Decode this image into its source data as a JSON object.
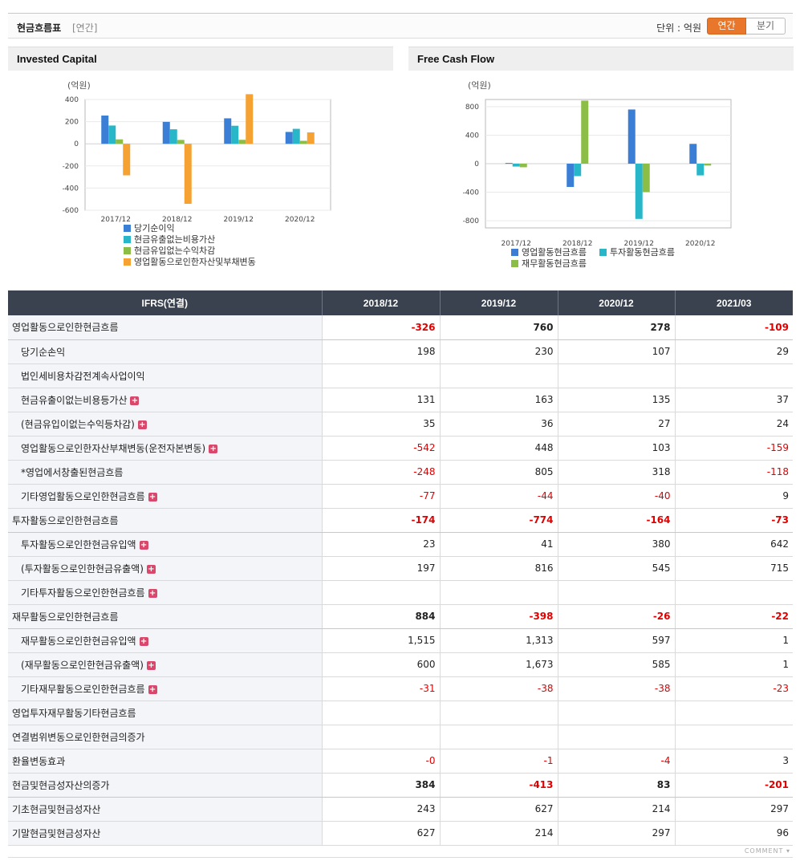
{
  "header": {
    "title": "현금흐름표",
    "period": "[연간]",
    "unit": "단위 : 억원",
    "toggle_annual": "연간",
    "toggle_quarter": "분기"
  },
  "colors": {
    "blue": "#3a7fd5",
    "cyan": "#28b7c8",
    "green": "#8cbd47",
    "orange": "#f5a233"
  },
  "charts": [
    {
      "id": "invested-capital",
      "title": "Invested Capital",
      "unit_label": "(억원)",
      "chart_data": {
        "type": "bar",
        "categories": [
          "2017/12",
          "2018/12",
          "2019/12",
          "2020/12"
        ],
        "ylim": [
          -600,
          400
        ],
        "yticks": [
          400,
          200,
          0,
          -200,
          -400,
          -600
        ],
        "series": [
          {
            "name": "당기순이익",
            "color": "blue",
            "values": [
              255,
              198,
              230,
              107
            ]
          },
          {
            "name": "현금유출없는비용가산",
            "color": "cyan",
            "values": [
              165,
              131,
              163,
              135
            ]
          },
          {
            "name": "현금유입없는수익차감",
            "color": "green",
            "values": [
              40,
              35,
              36,
              27
            ]
          },
          {
            "name": "영업활동으로인한자산및부채변동",
            "color": "orange",
            "values": [
              -285,
              -542,
              448,
              103
            ]
          }
        ],
        "grid": true,
        "legend": "bottom"
      }
    },
    {
      "id": "free-cash-flow",
      "title": "Free Cash Flow",
      "unit_label": "(억원)",
      "chart_data": {
        "type": "bar",
        "categories": [
          "2017/12",
          "2018/12",
          "2019/12",
          "2020/12"
        ],
        "ylim": [
          -900,
          900
        ],
        "yticks": [
          800,
          400,
          0,
          -400,
          -800
        ],
        "series": [
          {
            "name": "영업활동현금흐름",
            "color": "blue",
            "values": [
              10,
              -326,
              760,
              278
            ]
          },
          {
            "name": "투자활동현금흐름",
            "color": "cyan",
            "values": [
              -40,
              -174,
              -774,
              -164
            ]
          },
          {
            "name": "재무활동현금흐름",
            "color": "green",
            "values": [
              -50,
              884,
              -398,
              -26
            ]
          }
        ],
        "grid": true,
        "legend": "bottom"
      }
    }
  ],
  "table": {
    "corner": "IFRS(연결)",
    "columns": [
      "2018/12",
      "2019/12",
      "2020/12",
      "2021/03"
    ],
    "rows": [
      {
        "label": "영업활동으로인한현금흐름",
        "level": "main",
        "expand": false,
        "values": [
          "-326",
          "760",
          "278",
          "-109"
        ]
      },
      {
        "label": "당기순손익",
        "level": "sub",
        "expand": false,
        "values": [
          "198",
          "230",
          "107",
          "29"
        ]
      },
      {
        "label": "법인세비용차감전계속사업이익",
        "level": "sub",
        "expand": false,
        "values": [
          "",
          "",
          "",
          ""
        ]
      },
      {
        "label": "현금유출이없는비용등가산",
        "level": "sub",
        "expand": true,
        "values": [
          "131",
          "163",
          "135",
          "37"
        ]
      },
      {
        "label": "(현금유입이없는수익등차감)",
        "level": "sub",
        "expand": true,
        "values": [
          "35",
          "36",
          "27",
          "24"
        ]
      },
      {
        "label": "영업활동으로인한자산부채변동(운전자본변동)",
        "level": "sub",
        "expand": true,
        "values": [
          "-542",
          "448",
          "103",
          "-159"
        ]
      },
      {
        "label": "*영업에서창출된현금흐름",
        "level": "sub",
        "expand": false,
        "values": [
          "-248",
          "805",
          "318",
          "-118"
        ]
      },
      {
        "label": "기타영업활동으로인한현금흐름",
        "level": "sub",
        "expand": true,
        "values": [
          "-77",
          "-44",
          "-40",
          "9"
        ]
      },
      {
        "label": "투자활동으로인한현금흐름",
        "level": "main",
        "expand": false,
        "values": [
          "-174",
          "-774",
          "-164",
          "-73"
        ]
      },
      {
        "label": "투자활동으로인한현금유입액",
        "level": "sub",
        "expand": true,
        "values": [
          "23",
          "41",
          "380",
          "642"
        ]
      },
      {
        "label": "(투자활동으로인한현금유출액)",
        "level": "sub",
        "expand": true,
        "values": [
          "197",
          "816",
          "545",
          "715"
        ]
      },
      {
        "label": "기타투자활동으로인한현금흐름",
        "level": "sub",
        "expand": true,
        "values": [
          "",
          "",
          "",
          ""
        ]
      },
      {
        "label": "재무활동으로인한현금흐름",
        "level": "main",
        "expand": false,
        "values": [
          "884",
          "-398",
          "-26",
          "-22"
        ]
      },
      {
        "label": "재무활동으로인한현금유입액",
        "level": "sub",
        "expand": true,
        "values": [
          "1,515",
          "1,313",
          "597",
          "1"
        ]
      },
      {
        "label": "(재무활동으로인한현금유출액)",
        "level": "sub",
        "expand": true,
        "values": [
          "600",
          "1,673",
          "585",
          "1"
        ]
      },
      {
        "label": "기타재무활동으로인한현금흐름",
        "level": "sub",
        "expand": true,
        "values": [
          "-31",
          "-38",
          "-38",
          "-23"
        ]
      },
      {
        "label": "영업투자재무활동기타현금흐름",
        "level": "plain",
        "expand": false,
        "values": [
          "",
          "",
          "",
          ""
        ]
      },
      {
        "label": "연결범위변동으로인한현금의증가",
        "level": "plain",
        "expand": false,
        "values": [
          "",
          "",
          "",
          ""
        ]
      },
      {
        "label": "환율변동효과",
        "level": "plain",
        "expand": false,
        "values": [
          "-0",
          "-1",
          "-4",
          "3"
        ]
      },
      {
        "label": "현금및현금성자산의증가",
        "level": "main",
        "expand": false,
        "values": [
          "384",
          "-413",
          "83",
          "-201"
        ]
      },
      {
        "label": "기초현금및현금성자산",
        "level": "plain",
        "expand": false,
        "values": [
          "243",
          "627",
          "214",
          "297"
        ]
      },
      {
        "label": "기말현금및현금성자산",
        "level": "plain",
        "expand": false,
        "values": [
          "627",
          "214",
          "297",
          "96"
        ]
      }
    ]
  },
  "footer": {
    "comment": "COMMENT"
  }
}
